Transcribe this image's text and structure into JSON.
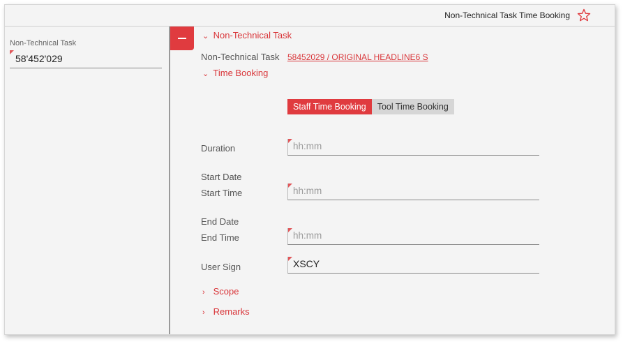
{
  "header": {
    "title": "Non-Technical Task Time Booking",
    "favorite_icon": "star-outline-icon",
    "accent": "#e03b3f"
  },
  "sidebar": {
    "label": "Non-Technical Task",
    "value": "58'452'029"
  },
  "collapse": {
    "icon": "minus-icon",
    "label": "—"
  },
  "sections": {
    "ntt": {
      "chevron": "⌄",
      "title": "Non-Technical Task",
      "field_label": "Non-Technical Task",
      "field_value": "58452029 / ORIGINAL HEADLINE6 S"
    },
    "time": {
      "chevron": "⌄",
      "title": "Time Booking"
    },
    "scope": {
      "chevron": "›",
      "title": "Scope"
    },
    "remarks": {
      "chevron": "›",
      "title": "Remarks"
    }
  },
  "tabs": [
    {
      "label": "Staff Time Booking",
      "active": true
    },
    {
      "label": "Tool Time Booking",
      "active": false
    }
  ],
  "form": {
    "duration": {
      "label": "Duration",
      "placeholder": "hh:mm"
    },
    "start_date": {
      "label": "Start Date"
    },
    "start_time": {
      "label": "Start Time",
      "placeholder": "hh:mm"
    },
    "end_date": {
      "label": "End Date"
    },
    "end_time": {
      "label": "End Time",
      "placeholder": "hh:mm"
    },
    "user_sign": {
      "label": "User Sign",
      "value": "XSCY"
    }
  }
}
